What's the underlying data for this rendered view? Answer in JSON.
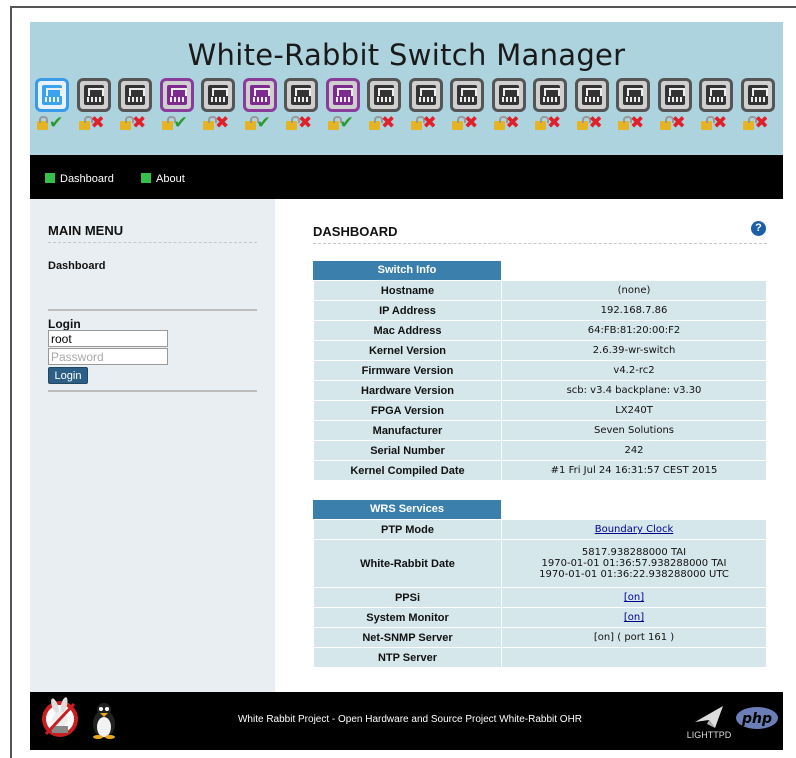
{
  "header": {
    "title": "White-Rabbit Switch Manager"
  },
  "ports": [
    {
      "state": "selected",
      "lock": "closed",
      "link": "ok"
    },
    {
      "state": "down",
      "lock": "open",
      "link": "bad"
    },
    {
      "state": "down",
      "lock": "open",
      "link": "bad"
    },
    {
      "state": "up",
      "lock": "open",
      "link": "ok"
    },
    {
      "state": "down",
      "lock": "open",
      "link": "bad"
    },
    {
      "state": "up",
      "lock": "open",
      "link": "ok"
    },
    {
      "state": "down",
      "lock": "open",
      "link": "bad"
    },
    {
      "state": "up",
      "lock": "open",
      "link": "ok"
    },
    {
      "state": "down",
      "lock": "open",
      "link": "bad"
    },
    {
      "state": "down",
      "lock": "open",
      "link": "bad"
    },
    {
      "state": "down",
      "lock": "open",
      "link": "bad"
    },
    {
      "state": "down",
      "lock": "open",
      "link": "bad"
    },
    {
      "state": "down",
      "lock": "open",
      "link": "bad"
    },
    {
      "state": "down",
      "lock": "open",
      "link": "bad"
    },
    {
      "state": "down",
      "lock": "open",
      "link": "bad"
    },
    {
      "state": "down",
      "lock": "open",
      "link": "bad"
    },
    {
      "state": "down",
      "lock": "open",
      "link": "bad"
    },
    {
      "state": "down",
      "lock": "open",
      "link": "bad"
    }
  ],
  "nav": {
    "dashboard": "Dashboard",
    "about": "About"
  },
  "sidebar": {
    "title": "MAIN MENU",
    "link_dashboard": "Dashboard",
    "login_label": "Login",
    "username_value": "root",
    "password_placeholder": "Password",
    "login_button": "Login"
  },
  "main": {
    "title": "DASHBOARD",
    "help_glyph": "?",
    "switch_info": {
      "heading": "Switch Info",
      "rows": [
        {
          "label": "Hostname",
          "value": "(none)"
        },
        {
          "label": "IP Address",
          "value": "192.168.7.86"
        },
        {
          "label": "Mac Address",
          "value": "64:FB:81:20:00:F2"
        },
        {
          "label": "Kernel Version",
          "value": "2.6.39-wr-switch"
        },
        {
          "label": "Firmware Version",
          "value": "v4.2-rc2"
        },
        {
          "label": "Hardware Version",
          "value": "scb: v3.4 backplane: v3.30"
        },
        {
          "label": "FPGA Version",
          "value": "LX240T"
        },
        {
          "label": "Manufacturer",
          "value": "Seven Solutions"
        },
        {
          "label": "Serial Number",
          "value": "242"
        },
        {
          "label": "Kernel Compiled Date",
          "value": "#1 Fri Jul 24 16:31:57 CEST 2015"
        }
      ]
    },
    "wrs_services": {
      "heading": "WRS Services",
      "ptp_mode_label": "PTP Mode",
      "ptp_mode_value": "Boundary Clock",
      "wr_date_label": "White-Rabbit Date",
      "wr_date_lines": [
        "5817.938288000 TAI",
        "1970-01-01 01:36:57.938288000 TAI",
        "1970-01-01 01:36:22.938288000 UTC"
      ],
      "ppsi_label": "PPSi",
      "ppsi_value": "[on]",
      "sysmon_label": "System Monitor",
      "sysmon_value": "[on]",
      "snmp_label": "Net-SNMP Server",
      "snmp_value": "[on] ( port 161 )",
      "ntp_label": "NTP Server",
      "ntp_value": ""
    }
  },
  "footer": {
    "text": "White Rabbit Project - Open Hardware and Source Project White-Rabbit OHR",
    "lighttpd_logo": "LIGHTTPD",
    "php_logo": "php"
  },
  "colors": {
    "header_bg": "#add3df",
    "nav_bg": "#000000",
    "section_head": "#3b7fad",
    "table_cell": "#d6e7ec",
    "port_up": "#7d2b8f",
    "port_selected": "#3aa3ee",
    "ok": "#2a9b2a",
    "bad": "#e0202a"
  }
}
